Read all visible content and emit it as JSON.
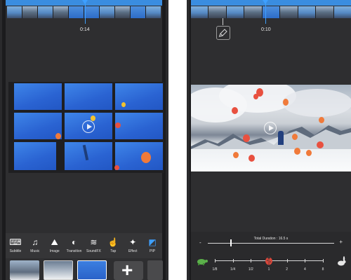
{
  "left_phone": {
    "timestamp": "0:14",
    "toolbar": [
      {
        "label": "Subtitle",
        "icon": "keyboard-icon",
        "glyph": "⌨"
      },
      {
        "label": "Music",
        "icon": "music-note-icon",
        "glyph": "♫"
      },
      {
        "label": "Image",
        "icon": "image-mountain-icon",
        "glyph": "⛰"
      },
      {
        "label": "Transition",
        "icon": "transition-icon",
        "glyph": "◐"
      },
      {
        "label": "SoundFX",
        "icon": "soundfx-icon",
        "glyph": "≋"
      },
      {
        "label": "Tap",
        "icon": "tap-hand-icon",
        "glyph": "☝"
      },
      {
        "label": "Effect",
        "icon": "effect-wand-icon",
        "glyph": "✦"
      },
      {
        "label": "PIP",
        "icon": "pip-icon",
        "glyph": "◩"
      }
    ],
    "add_label": "+"
  },
  "right_phone": {
    "timestamp": "0:10",
    "total_duration": "Total Duration : 16.5 s",
    "volume_minus": "-",
    "volume_plus": "+",
    "speed_ticks": [
      "1/8",
      "1/4",
      "1/2",
      "1",
      "2",
      "4",
      "8"
    ],
    "speed_value_fraction": 0.5,
    "duration_slider_fraction": 0.18
  },
  "colors": {
    "accent": "#3ea0ff",
    "sky_blue": "#2f6fd6",
    "balloon_red": "#e8503f",
    "balloon_orange": "#f07a3a",
    "balloon_yellow": "#f2c230"
  }
}
